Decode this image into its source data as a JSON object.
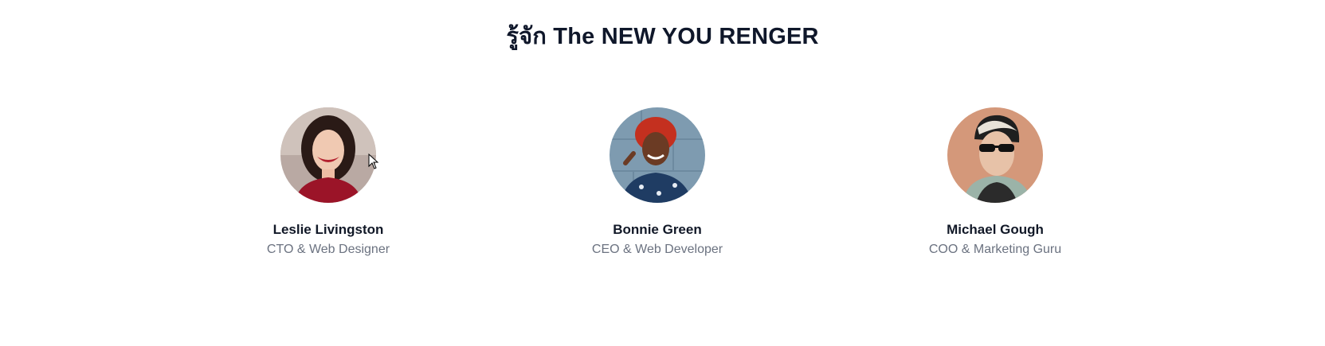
{
  "section": {
    "title": "รู้จัก The NEW YOU RENGER"
  },
  "members": [
    {
      "name": "Leslie Livingston",
      "role": "CTO & Web Designer",
      "avatar": "avatar-photo-woman-smiling"
    },
    {
      "name": "Bonnie Green",
      "role": "CEO & Web Developer",
      "avatar": "avatar-photo-woman-red-hair"
    },
    {
      "name": "Michael Gough",
      "role": "COO & Marketing Guru",
      "avatar": "avatar-photo-man-sunglasses"
    }
  ],
  "colors": {
    "title": "#0f172a",
    "name": "#111827",
    "role": "#6b7280",
    "background": "#ffffff"
  },
  "icons": {
    "cursor": "mouse-pointer-icon"
  }
}
